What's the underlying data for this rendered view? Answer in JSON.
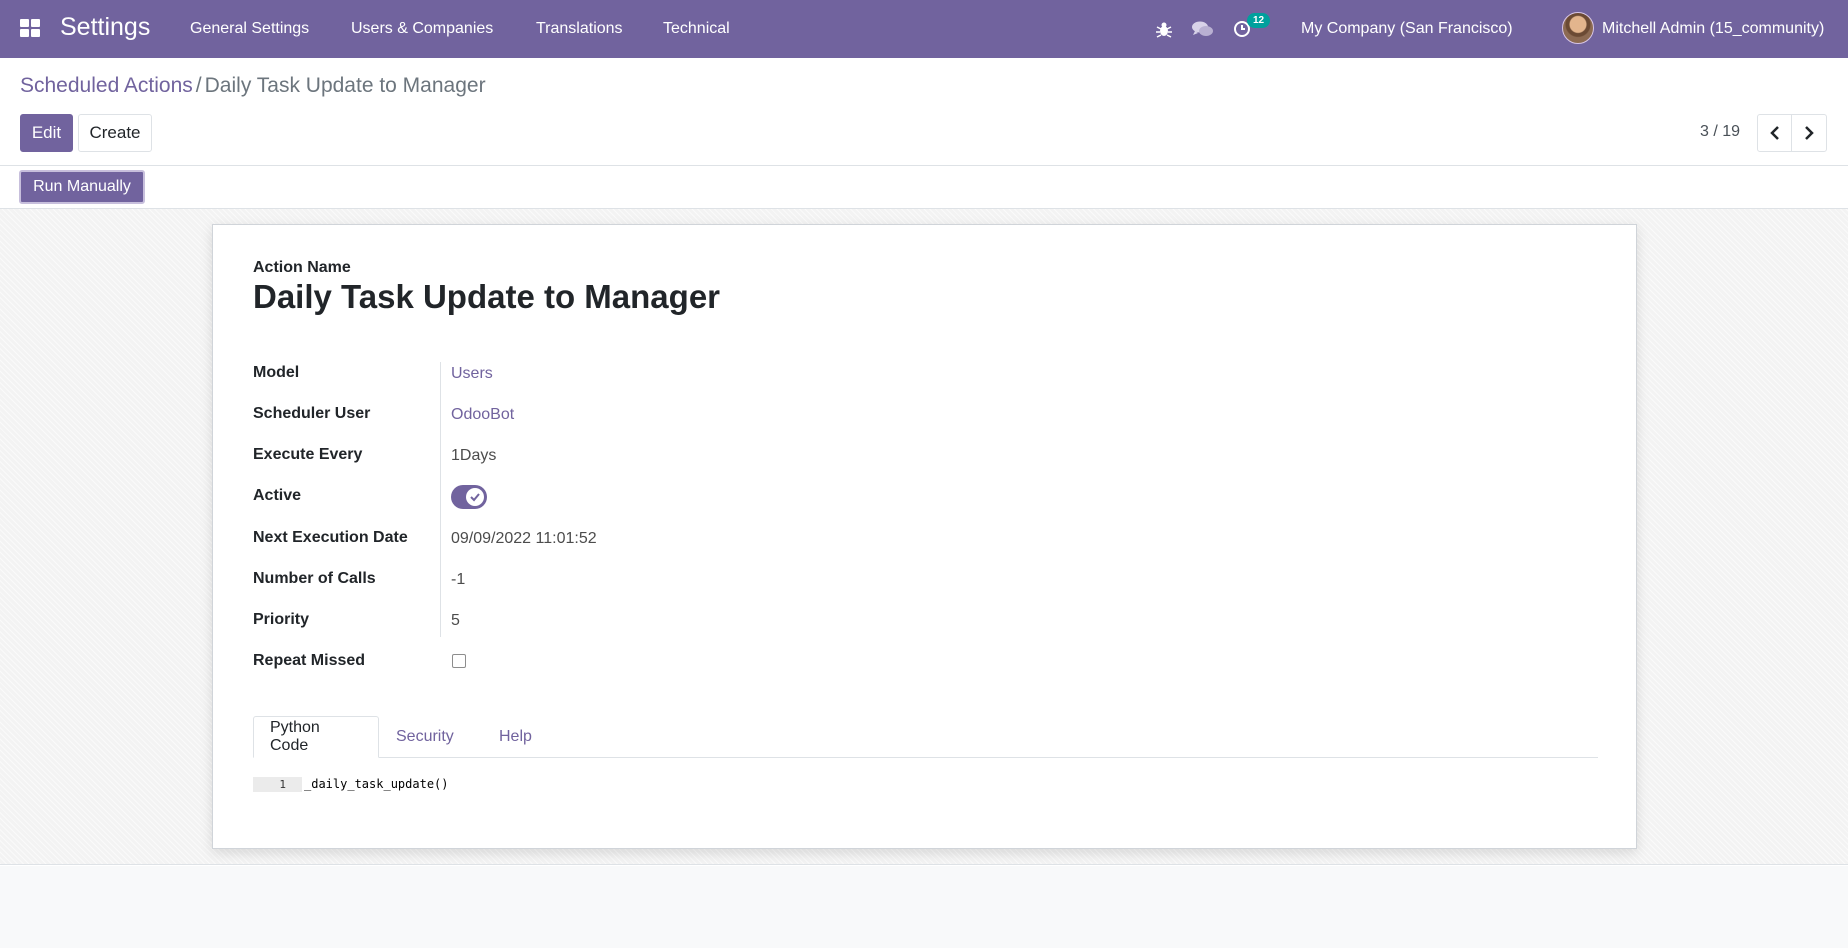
{
  "navbar": {
    "app_title": "Settings",
    "menu": [
      "General Settings",
      "Users & Companies",
      "Translations",
      "Technical"
    ],
    "activity_count": "12",
    "company": "My Company (San Francisco)",
    "user": "Mitchell Admin (15_community)",
    "icons": [
      "apps-icon",
      "bug-icon",
      "chat-icon",
      "clock-icon"
    ]
  },
  "breadcrumb": {
    "parent": "Scheduled Actions",
    "separator": "/",
    "current": "Daily Task Update to Manager"
  },
  "buttons": {
    "edit": "Edit",
    "create": "Create",
    "run_manually": "Run Manually"
  },
  "pager": {
    "value": "3 / 19"
  },
  "form": {
    "title_label": "Action Name",
    "title_value": "Daily Task Update to Manager",
    "fields": [
      {
        "label": "Model",
        "value": "Users"
      },
      {
        "label": "Scheduler User",
        "value": "OdooBot"
      },
      {
        "label": "Execute Every",
        "value": "1Days"
      },
      {
        "label": "Active",
        "value": true
      },
      {
        "label": "Next Execution Date",
        "value": "09/09/2022 11:01:52"
      },
      {
        "label": "Number of Calls",
        "value": "-1"
      },
      {
        "label": "Priority",
        "value": "5"
      },
      {
        "label": "Repeat Missed",
        "value": false
      }
    ]
  },
  "tabs": [
    "Python Code",
    "Security",
    "Help"
  ],
  "code": {
    "line_number": "1",
    "line": "_daily_task_update()"
  },
  "colors": {
    "brand": "#71639e",
    "badge": "#00a09d"
  }
}
